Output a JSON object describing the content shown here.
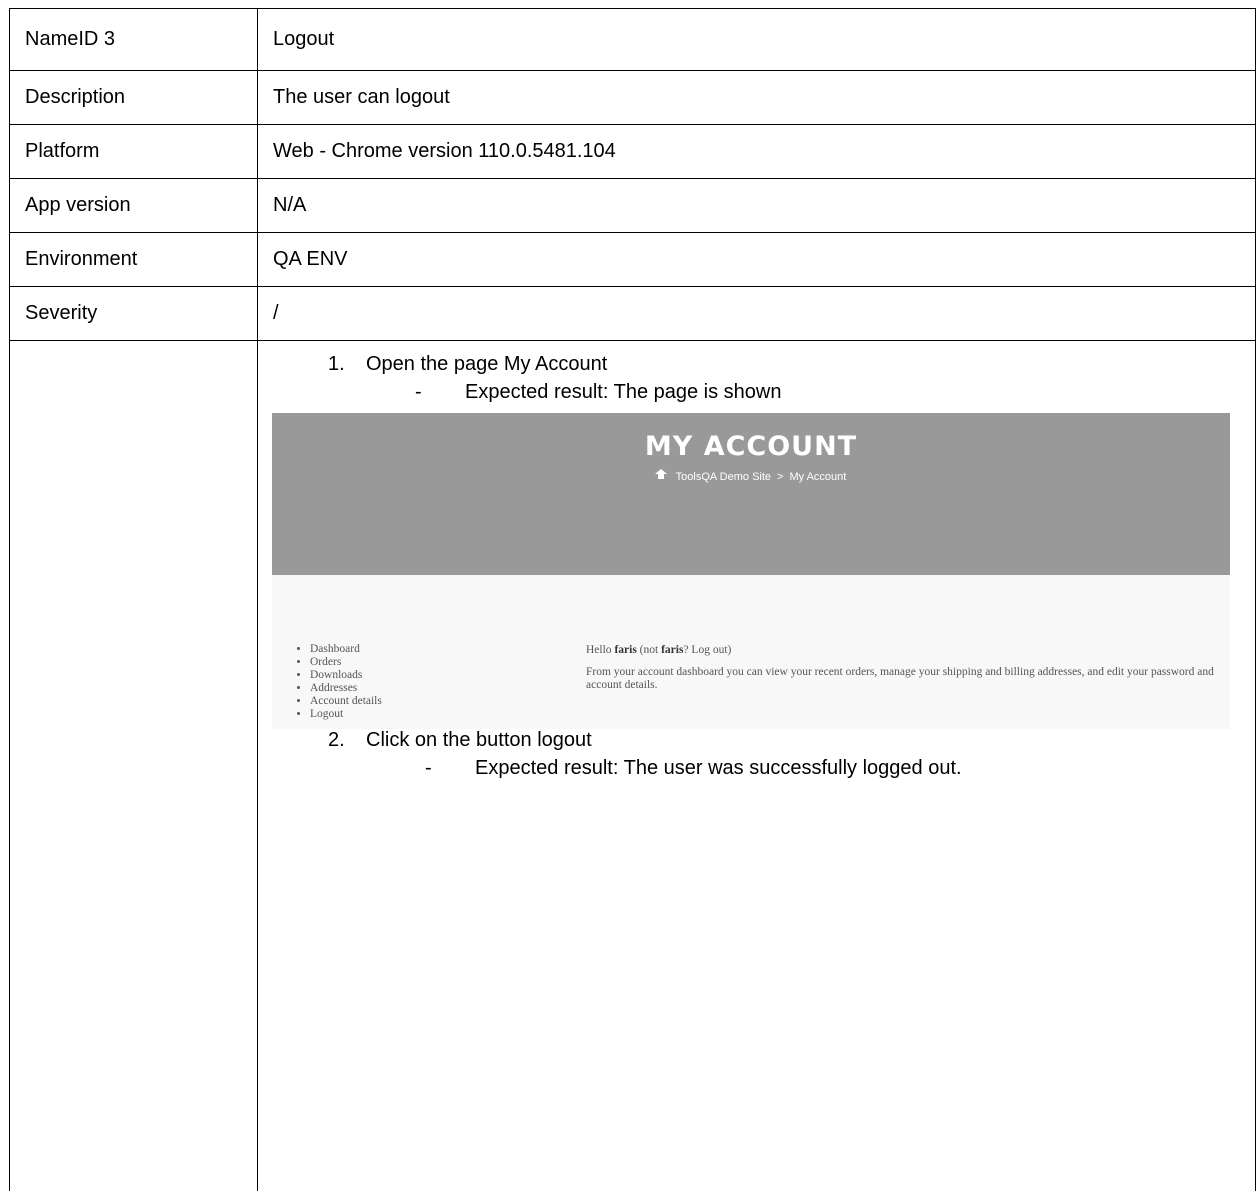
{
  "rows": [
    {
      "label": "NameID 3",
      "value": "Logout"
    },
    {
      "label": "Description",
      "value": "The user can logout"
    },
    {
      "label": "Platform",
      "value": "Web - Chrome version 110.0.5481.104"
    },
    {
      "label": "App version",
      "value": "N/A"
    },
    {
      "label": "Environment",
      "value": "QA ENV"
    },
    {
      "label": "Severity",
      "value": "/"
    }
  ],
  "steps": [
    {
      "num": "1.",
      "text": "Open the page My Account",
      "expected": "Expected result: The page is shown"
    },
    {
      "num": "2.",
      "text": "Click on the button logout",
      "expected": "Expected result: The user was successfully logged out."
    }
  ],
  "expected_dash": "-",
  "screenshot": {
    "title": "MY ACCOUNT",
    "breadcrumb_home": "ToolsQA Demo Site",
    "breadcrumb_sep": ">",
    "breadcrumb_current": "My Account",
    "nav": [
      "Dashboard",
      "Orders",
      "Downloads",
      "Addresses",
      "Account details",
      "Logout"
    ],
    "hello_prefix": "Hello ",
    "hello_user": "faris",
    "hello_mid": " (not ",
    "hello_user2": "faris",
    "hello_suffix": "? Log out)",
    "dashboard_text": "From your account dashboard you can view your recent orders, manage your shipping and billing addresses, and edit your password and account details.",
    "icon": "home-icon"
  }
}
